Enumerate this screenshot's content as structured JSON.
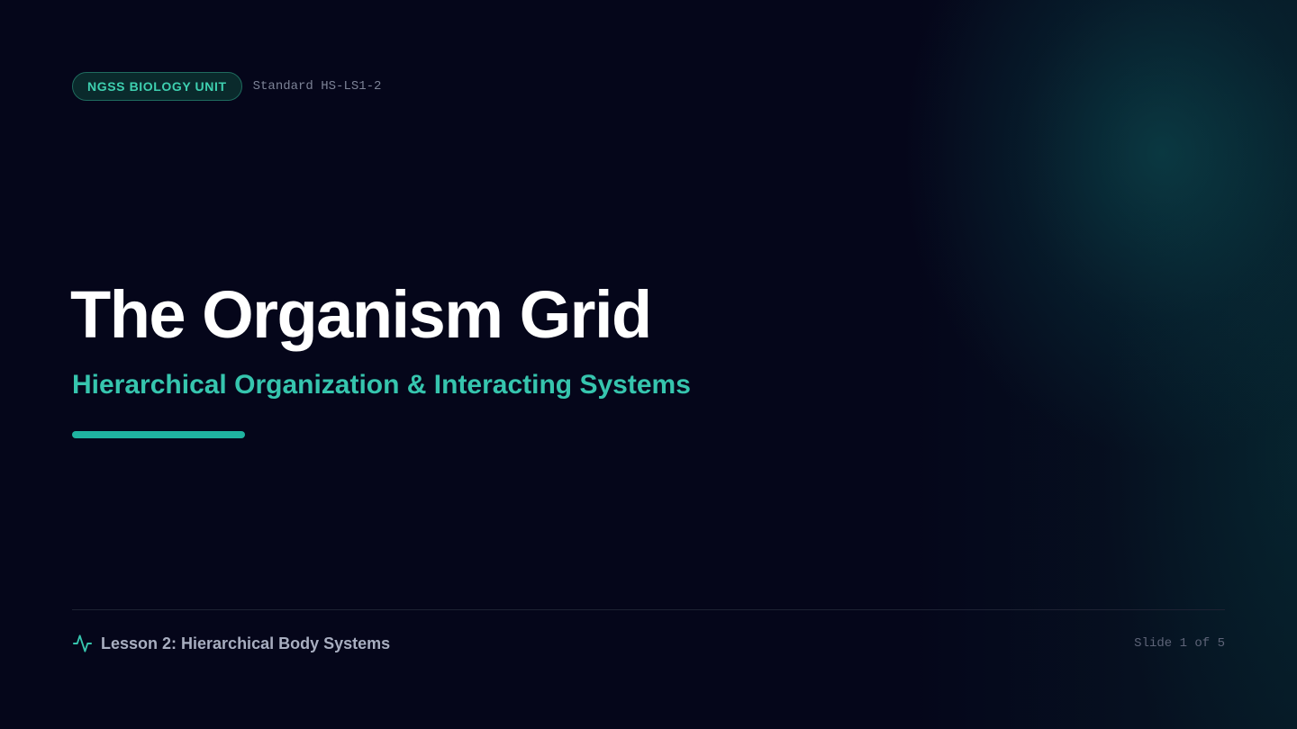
{
  "header": {
    "badge_label": "NGSS BIOLOGY UNIT",
    "standard_label": "Standard HS-LS1-2"
  },
  "hero": {
    "title": "The Organism Grid",
    "subtitle": "Hierarchical Organization & Interacting Systems"
  },
  "footer": {
    "icon": "pulse-icon",
    "lesson_label": "Lesson 2: Hierarchical Body Systems",
    "slide_counter": "Slide 1 of 5"
  },
  "colors": {
    "background": "#05061a",
    "accent": "#36c5ae",
    "badge_border": "#1f6b5e",
    "title": "#ffffff"
  }
}
